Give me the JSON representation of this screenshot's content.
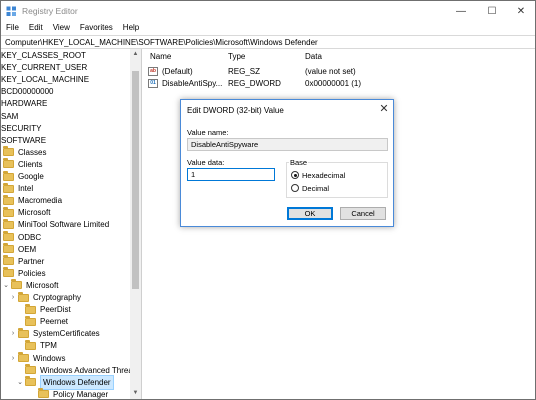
{
  "window": {
    "title": "Registry Editor",
    "controls": {
      "minimize": "—",
      "maximize": "☐",
      "close": "✕"
    }
  },
  "menu": [
    "File",
    "Edit",
    "View",
    "Favorites",
    "Help"
  ],
  "address": "Computer\\HKEY_LOCAL_MACHINE\\SOFTWARE\\Policies\\Microsoft\\Windows Defender",
  "tree": {
    "items": [
      {
        "label": "KEY_CLASSES_ROOT",
        "folder": false,
        "expander": ""
      },
      {
        "label": "KEY_CURRENT_USER",
        "folder": false,
        "expander": ""
      },
      {
        "label": "KEY_LOCAL_MACHINE",
        "folder": false,
        "expander": ""
      },
      {
        "label": "BCD00000000",
        "folder": false,
        "expander": ""
      },
      {
        "label": "HARDWARE",
        "folder": false,
        "expander": ""
      },
      {
        "label": "SAM",
        "folder": false,
        "expander": ""
      },
      {
        "label": "SECURITY",
        "folder": false,
        "expander": ""
      },
      {
        "label": "SOFTWARE",
        "folder": false,
        "expander": ""
      },
      {
        "label": "Classes",
        "folder": true,
        "expander": ""
      },
      {
        "label": "Clients",
        "folder": true,
        "expander": ""
      },
      {
        "label": "Google",
        "folder": true,
        "expander": ""
      },
      {
        "label": "Intel",
        "folder": true,
        "expander": ""
      },
      {
        "label": "Macromedia",
        "folder": true,
        "expander": ""
      },
      {
        "label": "Microsoft",
        "folder": true,
        "expander": ""
      },
      {
        "label": "MiniTool Software Limited",
        "folder": true,
        "expander": ""
      },
      {
        "label": "ODBC",
        "folder": true,
        "expander": ""
      },
      {
        "label": "OEM",
        "folder": true,
        "expander": ""
      },
      {
        "label": "Partner",
        "folder": true,
        "expander": ""
      },
      {
        "label": "Policies",
        "folder": true,
        "expander": ""
      },
      {
        "label": "Microsoft",
        "folder": true,
        "expander": "⌄"
      },
      {
        "label": "Cryptography",
        "folder": true,
        "expander": "›"
      },
      {
        "label": "PeerDist",
        "folder": true,
        "expander": ""
      },
      {
        "label": "Peernet",
        "folder": true,
        "expander": ""
      },
      {
        "label": "SystemCertificates",
        "folder": true,
        "expander": "›"
      },
      {
        "label": "TPM",
        "folder": true,
        "expander": ""
      },
      {
        "label": "Windows",
        "folder": true,
        "expander": "›"
      },
      {
        "label": "Windows Advanced Threat",
        "folder": true,
        "expander": ""
      },
      {
        "label": "Windows Defender",
        "folder": true,
        "expander": "⌄",
        "selected": true
      },
      {
        "label": "Policy Manager",
        "folder": true,
        "expander": ""
      }
    ]
  },
  "values_pane": {
    "columns": {
      "name": "Name",
      "type": "Type",
      "data": "Data"
    },
    "rows": [
      {
        "icon": "string-value-icon",
        "icon_text": "ab",
        "name": "(Default)",
        "type": "REG_SZ",
        "data": "(value not set)"
      },
      {
        "icon": "dword-value-icon",
        "icon_text": "01",
        "name": "DisableAntiSpy...",
        "type": "REG_DWORD",
        "data": "0x00000001 (1)"
      }
    ]
  },
  "dialog": {
    "title": "Edit DWORD (32-bit) Value",
    "close": "✕",
    "value_name_label": "Value name:",
    "value_name": "DisableAntiSpyware",
    "value_data_label": "Value data:",
    "value_data": "1",
    "base_label": "Base",
    "base_options": [
      {
        "label": "Hexadecimal",
        "selected": true
      },
      {
        "label": "Decimal",
        "selected": false
      }
    ],
    "ok_label": "OK",
    "cancel_label": "Cancel"
  },
  "colors": {
    "selection_bg": "#cce8ff",
    "dialog_border": "#4a8ad8",
    "folder": "#e8c15a"
  }
}
